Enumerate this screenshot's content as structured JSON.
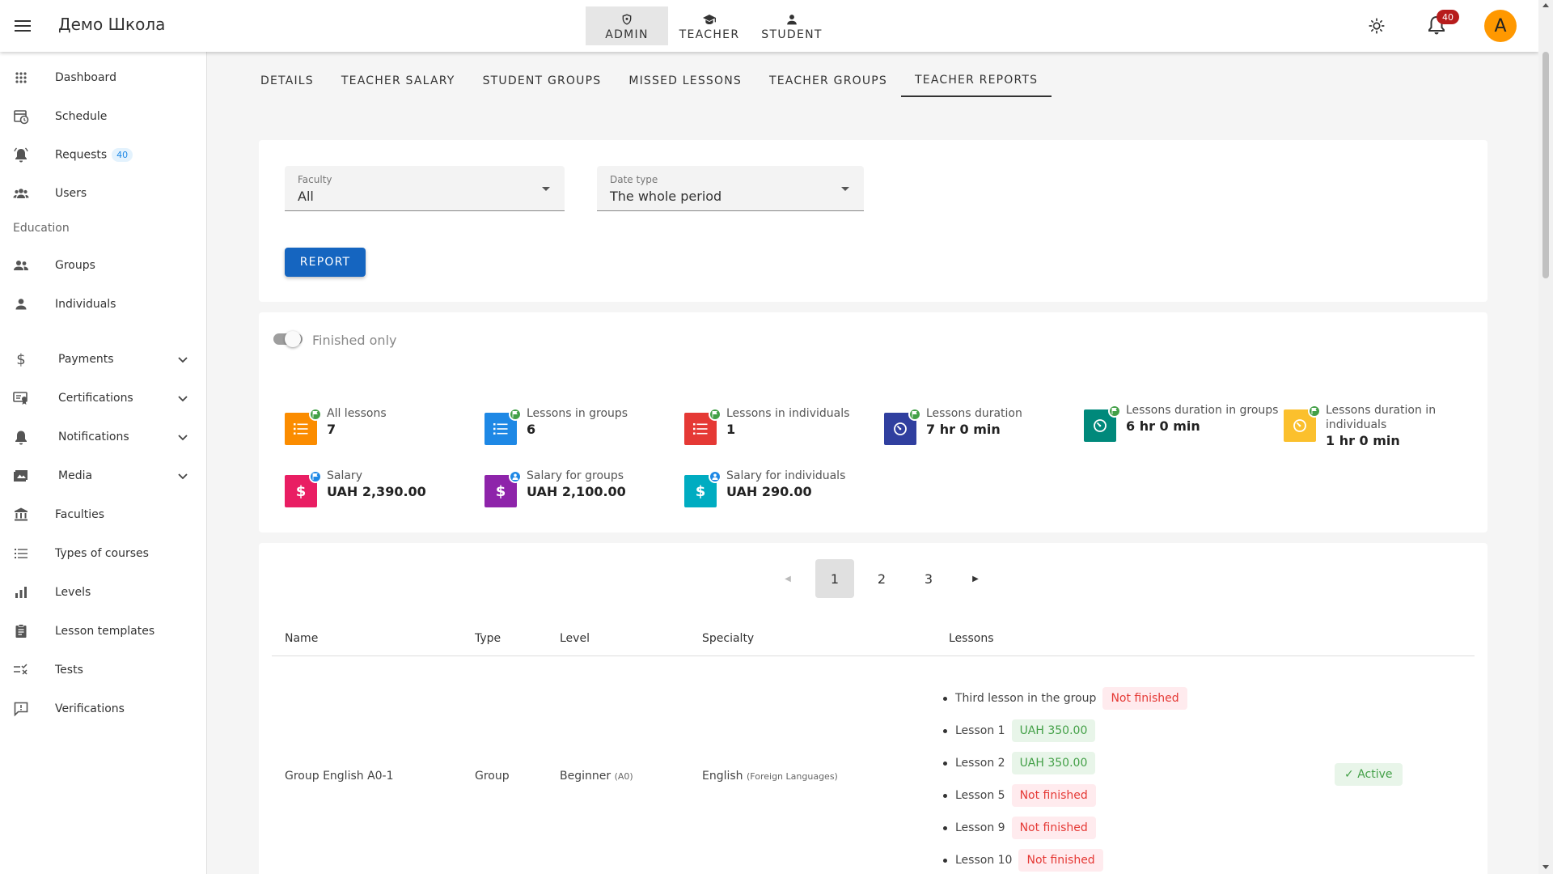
{
  "header": {
    "title": "Демо Школа",
    "roles": [
      {
        "label": "ADMIN",
        "icon": "shield-icon"
      },
      {
        "label": "TEACHER",
        "icon": "graduation-cap-icon"
      },
      {
        "label": "STUDENT",
        "icon": "person-icon"
      }
    ],
    "notifications_count": "40",
    "avatar_letter": "A"
  },
  "sidebar": {
    "items": [
      {
        "label": "Dashboard",
        "icon": "dashboard-grid-icon"
      },
      {
        "label": "Schedule",
        "icon": "calendar-clock-icon"
      },
      {
        "label": "Requests",
        "icon": "bell-ring-icon",
        "badge": "40"
      },
      {
        "label": "Users",
        "icon": "users-icon"
      }
    ],
    "section_label": "Education",
    "education_items": [
      {
        "label": "Groups",
        "icon": "group-icon"
      },
      {
        "label": "Individuals",
        "icon": "person-icon"
      }
    ],
    "more_items": [
      {
        "label": "Payments",
        "icon": "dollar-icon"
      },
      {
        "label": "Certifications",
        "icon": "certificate-icon"
      },
      {
        "label": "Notifications",
        "icon": "bell-icon"
      },
      {
        "label": "Media",
        "icon": "image-icon"
      },
      {
        "label": "Faculties",
        "icon": "bank-icon"
      },
      {
        "label": "Types of courses",
        "icon": "list-icon"
      },
      {
        "label": "Levels",
        "icon": "bar-chart-icon"
      },
      {
        "label": "Lesson templates",
        "icon": "clipboard-icon"
      },
      {
        "label": "Tests",
        "icon": "checklist-icon"
      },
      {
        "label": "Verifications",
        "icon": "feedback-icon"
      }
    ]
  },
  "tabs": [
    "DETAILS",
    "TEACHER SALARY",
    "STUDENT GROUPS",
    "MISSED LESSONS",
    "TEACHER GROUPS",
    "TEACHER REPORTS"
  ],
  "filters": {
    "faculty_label": "Faculty",
    "faculty_value": "All",
    "date_type_label": "Date type",
    "date_type_value": "The whole period",
    "report_button": "REPORT"
  },
  "stats": {
    "toggle_label": "Finished only",
    "items": [
      {
        "title": "All lessons",
        "value": "7",
        "color": "#fb8c00",
        "badge_color": "#43a047"
      },
      {
        "title": "Lessons in groups",
        "value": "6",
        "color": "#1e88e5",
        "badge_color": "#43a047"
      },
      {
        "title": "Lessons in individuals",
        "value": "1",
        "color": "#e53935",
        "badge_color": "#43a047"
      },
      {
        "title": "Lessons duration",
        "value": "7 hr 0 min",
        "color": "#303f9f",
        "badge_color": "#43a047"
      },
      {
        "title": "Lessons duration in groups",
        "value": "6 hr 0 min",
        "color": "#00897b",
        "badge_color": "#43a047"
      },
      {
        "title": "Lessons duration in individuals",
        "value": "1 hr 0 min",
        "color": "#fbc02d",
        "badge_color": "#43a047"
      },
      {
        "title": "Salary",
        "value": "UAH 2,390.00",
        "color": "#e91e63",
        "badge_color": "#1e88e5"
      },
      {
        "title": "Salary for groups",
        "value": "UAH 2,100.00",
        "color": "#8e24aa",
        "badge_color": "#1e88e5"
      },
      {
        "title": "Salary for individuals",
        "value": "UAH 290.00",
        "color": "#00acc1",
        "badge_color": "#1e88e5"
      }
    ]
  },
  "pagination": {
    "pages": [
      "1",
      "2",
      "3"
    ],
    "current": "1"
  },
  "table": {
    "headers": [
      "Name",
      "Type",
      "Level",
      "Specialty",
      "Lessons"
    ],
    "rows": [
      {
        "name": "Group English A0-1",
        "type": "Group",
        "level": "Beginner",
        "level_code": "(A0)",
        "specialty": "English",
        "specialty_note": "(Foreign Languages)",
        "status": "Active",
        "lessons": [
          {
            "name": "Third lesson in the group",
            "chip": "Not finished",
            "kind": "red"
          },
          {
            "name": "Lesson 1",
            "chip": "UAH 350.00",
            "kind": "green"
          },
          {
            "name": "Lesson 2",
            "chip": "UAH 350.00",
            "kind": "green"
          },
          {
            "name": "Lesson 5",
            "chip": "Not finished",
            "kind": "red"
          },
          {
            "name": "Lesson 9",
            "chip": "Not finished",
            "kind": "red"
          },
          {
            "name": "Lesson 10",
            "chip": "Not finished",
            "kind": "red"
          }
        ]
      }
    ]
  }
}
